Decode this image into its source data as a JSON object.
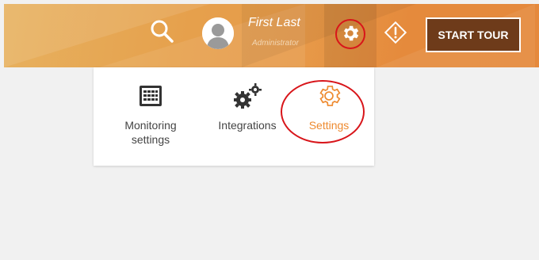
{
  "header": {
    "user": {
      "name": "First Last",
      "role": "Administrator"
    },
    "start_tour_label": "START TOUR",
    "icons": {
      "search": "search-icon",
      "avatar": "user-avatar-icon",
      "gear": "gear-icon",
      "alert": "alert-diamond-icon"
    },
    "accent_color": "#e5893c",
    "highlight_color": "#d8151a"
  },
  "dropdown": {
    "items": [
      {
        "label_line1": "Monitoring",
        "label_line2": "settings",
        "icon": "grid-calendar-icon"
      },
      {
        "label": "Integrations",
        "icon": "gears-icon"
      },
      {
        "label": "Settings",
        "icon": "settings-gear-outline-icon",
        "active_color": "#ee8a2f"
      }
    ]
  }
}
